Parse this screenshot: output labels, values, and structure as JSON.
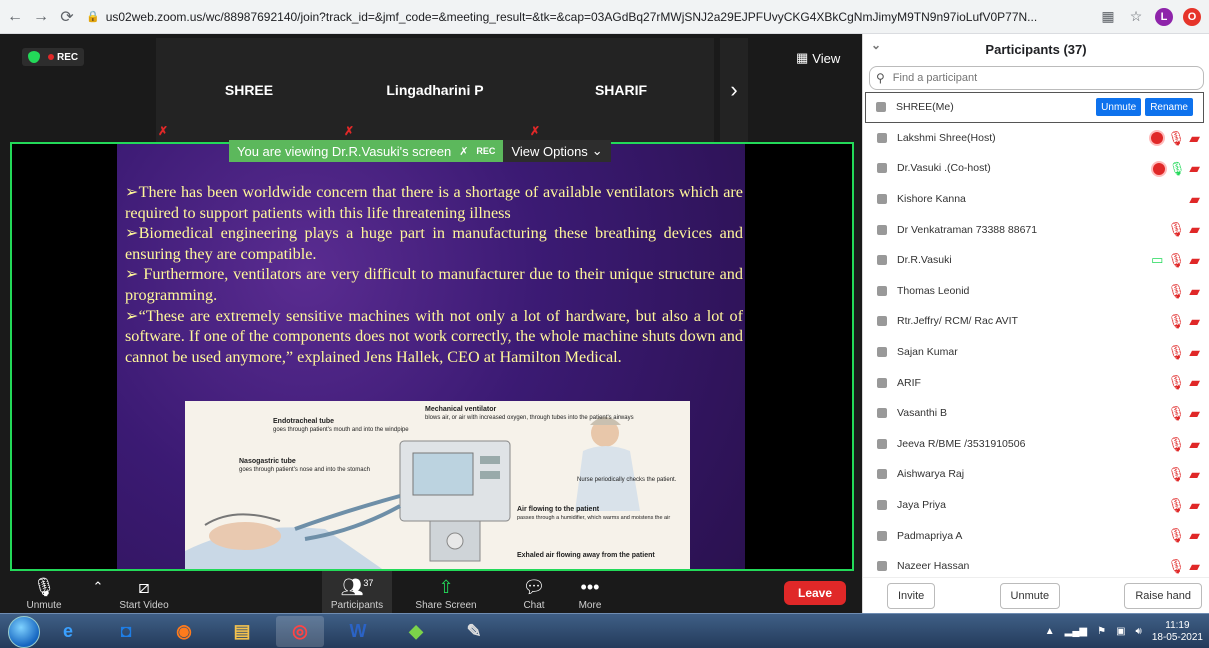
{
  "browser": {
    "url": "us02web.zoom.us/wc/88987692140/join?track_id=&jmf_code=&meeting_result=&tk=&cap=03AGdBq27rMWjSNJ2a29EJPFUvyCKG4XBkCgNmJimyM9TN9n97ioLufV0P77N...",
    "profile_initial": "L"
  },
  "meeting": {
    "rec_label": "REC",
    "view_label": "View",
    "tiles": [
      "SHREE",
      "Lingadharini P",
      "SHARIF"
    ],
    "banner_text": "You are viewing Dr.R.Vasuki's screen",
    "banner_rec": "REC",
    "view_options": "View Options"
  },
  "slide": {
    "paragraphs": [
      "➢There has been worldwide concern that there is a shortage of available ventilators which are required to support patients with this life threatening illness",
      "➢Biomedical engineering plays a huge part in manufacturing these breathing devices and ensuring they are compatible.",
      "➢ Furthermore, ventilators are very difficult to manufacturer due to their unique structure and programming.",
      "➢“These are extremely sensitive machines with not only a lot of hardware, but also a lot of software. If one of the components does not work correctly, the whole machine shuts down and cannot be used anymore,” explained Jens Hallek, CEO at Hamilton Medical."
    ],
    "diagram_labels": {
      "endotracheal_bold": "Endotracheal tube",
      "endotracheal_rest": "goes through patient's mouth and into the windpipe",
      "mechanical_bold": "Mechanical ventilator",
      "mechanical_rest": "blows air, or air with increased oxygen, through tubes into the patient's airways",
      "nasogastric_bold": "Nasogastric tube",
      "nasogastric_rest": "goes through patient's nose and into the stomach",
      "nurse": "Nurse periodically checks the patient.",
      "air_bold": "Air flowing to the patient",
      "air_rest": "passes through a humidifier, which warms and moistens the air",
      "exhaled_bold": "Exhaled air flowing away from the patient"
    }
  },
  "toolbar": {
    "unmute": "Unmute",
    "start_video": "Start Video",
    "participants": "Participants",
    "participants_count": "37",
    "share_screen": "Share Screen",
    "chat": "Chat",
    "more": "More",
    "leave": "Leave"
  },
  "panel": {
    "title": "Participants (37)",
    "search_placeholder": "Find a participant",
    "unmute_btn": "Unmute",
    "rename_btn": "Rename",
    "participants": [
      {
        "name": "SHREE(Me)",
        "icons": []
      },
      {
        "name": "Lakshmi Shree(Host)",
        "icons": [
          "rec",
          "micoff",
          "vidoff"
        ]
      },
      {
        "name": "Dr.Vasuki .(Co-host)",
        "icons": [
          "rec",
          "micon",
          "vidoff"
        ]
      },
      {
        "name": "Kishore Kanna",
        "icons": [
          "vidoff"
        ]
      },
      {
        "name": "Dr Venkatraman 73388 88671",
        "icons": [
          "micoff",
          "vidoff"
        ]
      },
      {
        "name": "Dr.R.Vasuki",
        "icons": [
          "share",
          "micoff",
          "vidoff"
        ]
      },
      {
        "name": "Thomas Leonid",
        "icons": [
          "micoff",
          "vidoff"
        ]
      },
      {
        "name": "Rtr.Jeffry/ RCM/ Rac AVIT",
        "icons": [
          "micoff",
          "vidoff"
        ]
      },
      {
        "name": "Sajan Kumar",
        "icons": [
          "micoff",
          "vidoff"
        ]
      },
      {
        "name": "ARIF",
        "icons": [
          "micoff",
          "vidoff"
        ]
      },
      {
        "name": "Vasanthi B",
        "icons": [
          "micoff",
          "vidoff"
        ]
      },
      {
        "name": "Jeeva R/BME /3531910506",
        "icons": [
          "micoff",
          "vidoff"
        ]
      },
      {
        "name": "Aishwarya Raj",
        "icons": [
          "micoff",
          "vidoff"
        ]
      },
      {
        "name": "Jaya Priya",
        "icons": [
          "micoff",
          "vidoff"
        ]
      },
      {
        "name": "Padmapriya A",
        "icons": [
          "micoff",
          "vidoff"
        ]
      },
      {
        "name": "Nazeer Hassan",
        "icons": [
          "micoff",
          "vidoff"
        ]
      }
    ],
    "invite": "Invite",
    "unmute_all": "Unmute",
    "raise_hand": "Raise hand"
  },
  "taskbar": {
    "time": "11:19",
    "date": "18-05-2021"
  },
  "colors": {
    "zoom_blue": "#0e72ed",
    "share_green": "#23d959",
    "leave_red": "#e02828",
    "slide_text": "#fff79a"
  }
}
